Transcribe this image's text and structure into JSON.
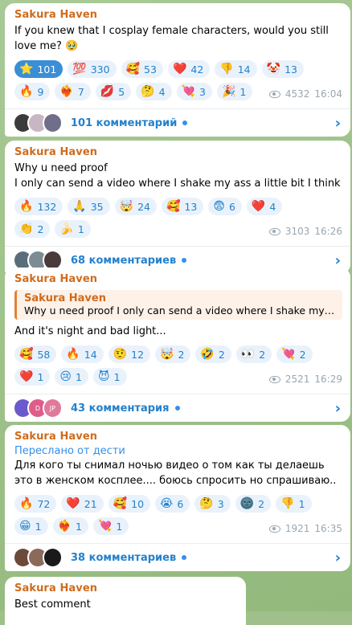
{
  "colors": {
    "author": "#d06b1c",
    "link": "#2481cc",
    "chip_bg": "#e9f2fb",
    "chip_selected_bg": "#3a8ed6"
  },
  "messages": [
    {
      "author": "Sakura Haven",
      "text": "If you knew that I cosplay female characters, would you still love me? 🥹",
      "reactions": [
        {
          "emoji": "⭐",
          "count": "101",
          "selected": true
        },
        {
          "emoji": "💯",
          "count": "330"
        },
        {
          "emoji": "🥰",
          "count": "53"
        },
        {
          "emoji": "❤️",
          "count": "42"
        },
        {
          "emoji": "👎",
          "count": "14"
        },
        {
          "emoji": "🤡",
          "count": "13"
        },
        {
          "emoji": "🔥",
          "count": "9"
        },
        {
          "emoji": "❤️‍🔥",
          "count": "7"
        },
        {
          "emoji": "💋",
          "count": "5"
        },
        {
          "emoji": "🤔",
          "count": "4"
        },
        {
          "emoji": "💘",
          "count": "3"
        },
        {
          "emoji": "🎉",
          "count": "1"
        }
      ],
      "views": "4532",
      "time": "16:04",
      "comments_label": "101 комментарий"
    },
    {
      "author": "Sakura Haven",
      "text_lines": [
        "Why u need proof",
        "I only can send a video where I shake my ass a little bit I think"
      ],
      "reactions": [
        {
          "emoji": "🔥",
          "count": "132"
        },
        {
          "emoji": "🙏",
          "count": "35"
        },
        {
          "emoji": "🤯",
          "count": "24"
        },
        {
          "emoji": "🥰",
          "count": "13"
        },
        {
          "emoji": "😨",
          "count": "6"
        },
        {
          "emoji": "❤️",
          "count": "4"
        },
        {
          "emoji": "👏",
          "count": "2"
        },
        {
          "emoji": "🍌",
          "count": "1"
        }
      ],
      "views": "3103",
      "time": "16:26",
      "comments_label": "68 комментариев"
    },
    {
      "author": "Sakura Haven",
      "reply_author": "Sakura Haven",
      "reply_text": "Why u need proof  I only can send a video where I shake my ass ...",
      "text": "And it's night and bad light...",
      "reactions": [
        {
          "emoji": "🥰",
          "count": "58"
        },
        {
          "emoji": "🔥",
          "count": "14"
        },
        {
          "emoji": "🤨",
          "count": "12"
        },
        {
          "emoji": "🤯",
          "count": "2"
        },
        {
          "emoji": "🤣",
          "count": "2"
        },
        {
          "emoji": "👀",
          "count": "2"
        },
        {
          "emoji": "💘",
          "count": "2"
        },
        {
          "emoji": "❤️",
          "count": "1"
        },
        {
          "emoji": "😢",
          "count": "1"
        },
        {
          "emoji": "😈",
          "count": "1"
        }
      ],
      "views": "2521",
      "time": "16:29",
      "comments_label": "43 комментария",
      "avatar_letters": [
        "D",
        "JP"
      ]
    },
    {
      "author": "Sakura Haven",
      "forwarded": "Переслано от дести",
      "text": "Для кого ты снимал ночью видео о том как ты делаешь это в женском косплее.... боюсь спросить но спрашиваю..",
      "reactions": [
        {
          "emoji": "🔥",
          "count": "72"
        },
        {
          "emoji": "❤️",
          "count": "21"
        },
        {
          "emoji": "🥰",
          "count": "10"
        },
        {
          "emoji": "😭",
          "count": "6"
        },
        {
          "emoji": "🤔",
          "count": "3"
        },
        {
          "emoji": "🌚",
          "count": "2"
        },
        {
          "emoji": "👎",
          "count": "1"
        },
        {
          "emoji": "😁",
          "count": "1"
        },
        {
          "emoji": "❤️‍🔥",
          "count": "1"
        },
        {
          "emoji": "💘",
          "count": "1"
        }
      ],
      "views": "1921",
      "time": "16:35",
      "comments_label": "38 комментариев"
    },
    {
      "author": "Sakura Haven",
      "text": "Best comment"
    }
  ]
}
